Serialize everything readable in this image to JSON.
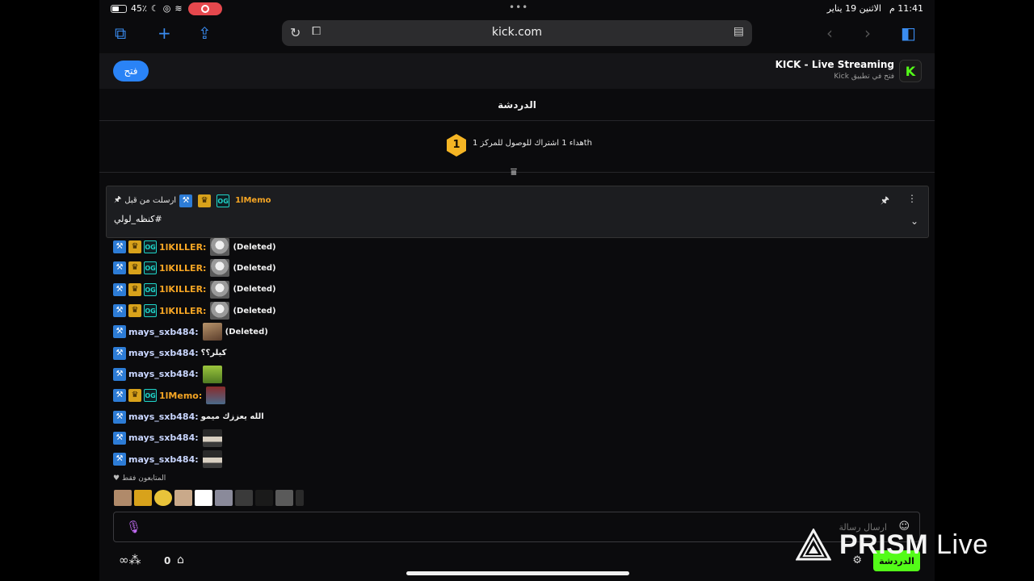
{
  "status_bar": {
    "battery": "45٪",
    "time": "11:41 م",
    "date": "الاثنين 19 يناير"
  },
  "browser": {
    "url": "kick.com"
  },
  "app_banner": {
    "open_label": "فتح",
    "title": "KICK - Live Streaming",
    "subtitle": "فتح في تطبيق Kick",
    "logo_letter": "K"
  },
  "chat": {
    "title": "الدردشة",
    "goal": {
      "badge_value": "1",
      "text": "هداء 1 اشتراك للوصول للمركز 1th"
    },
    "pinned": {
      "sent_by_label": "ارسلت من قبل",
      "username": "1lMemo",
      "message": "كنظه_لولي#"
    },
    "messages": [
      {
        "username": "1lKILLER:",
        "color": "orange",
        "badges": [
          "mod",
          "vip",
          "og"
        ],
        "emote": "dog",
        "text": "(Deleted)"
      },
      {
        "username": "1lKILLER:",
        "color": "orange",
        "badges": [
          "mod",
          "vip",
          "og"
        ],
        "emote": "dog",
        "text": "(Deleted)"
      },
      {
        "username": "1lKILLER:",
        "color": "orange",
        "badges": [
          "mod",
          "vip",
          "og"
        ],
        "emote": "dog",
        "text": "(Deleted)"
      },
      {
        "username": "1lKILLER:",
        "color": "orange",
        "badges": [
          "mod",
          "vip",
          "og"
        ],
        "emote": "dog",
        "text": "(Deleted)"
      },
      {
        "username": "mays_sxb484:",
        "color": "blue",
        "badges": [
          "mod"
        ],
        "emote": "face",
        "text": "(Deleted)"
      },
      {
        "username": "mays_sxb484:",
        "color": "blue",
        "badges": [
          "mod"
        ],
        "emote": "",
        "text": "كيلر؟؟"
      },
      {
        "username": "mays_sxb484:",
        "color": "blue",
        "badges": [
          "mod"
        ],
        "emote": "green",
        "text": ""
      },
      {
        "username": "1lMemo:",
        "color": "orange",
        "badges": [
          "mod",
          "vip",
          "og"
        ],
        "emote": "red",
        "text": ""
      },
      {
        "username": "mays_sxb484:",
        "color": "blue",
        "badges": [
          "mod"
        ],
        "emote": "",
        "text": "الله يعززك ميمو"
      },
      {
        "username": "mays_sxb484:",
        "color": "blue",
        "badges": [
          "mod"
        ],
        "emote": "dark",
        "text": ""
      },
      {
        "username": "mays_sxb484:",
        "color": "blue",
        "badges": [
          "mod"
        ],
        "emote": "dark",
        "text": ""
      }
    ],
    "followers_only_label": "المتابعون فقط",
    "input_placeholder": "ارسال رسالة",
    "points": "0",
    "send_label": "الدردشة"
  },
  "watermark": {
    "brand_bold": "PRISM",
    "brand_light": "Live"
  },
  "colors": {
    "accent_green": "#53fc18",
    "link_blue": "#2a83f6",
    "username_orange": "#f5a524"
  },
  "icons": {
    "tabs": "tabs-icon",
    "new_tab": "plus-icon",
    "share": "share-icon",
    "reload": "reload-icon",
    "reader": "reader-icon",
    "sidebar": "sidebar-icon",
    "pin": "pin-icon",
    "kebab": "kebab-icon",
    "chevron": "chevron-down-icon",
    "mic": "mic-icon",
    "smile": "smile-icon",
    "settings": "gear-icon",
    "store": "store-icon"
  }
}
